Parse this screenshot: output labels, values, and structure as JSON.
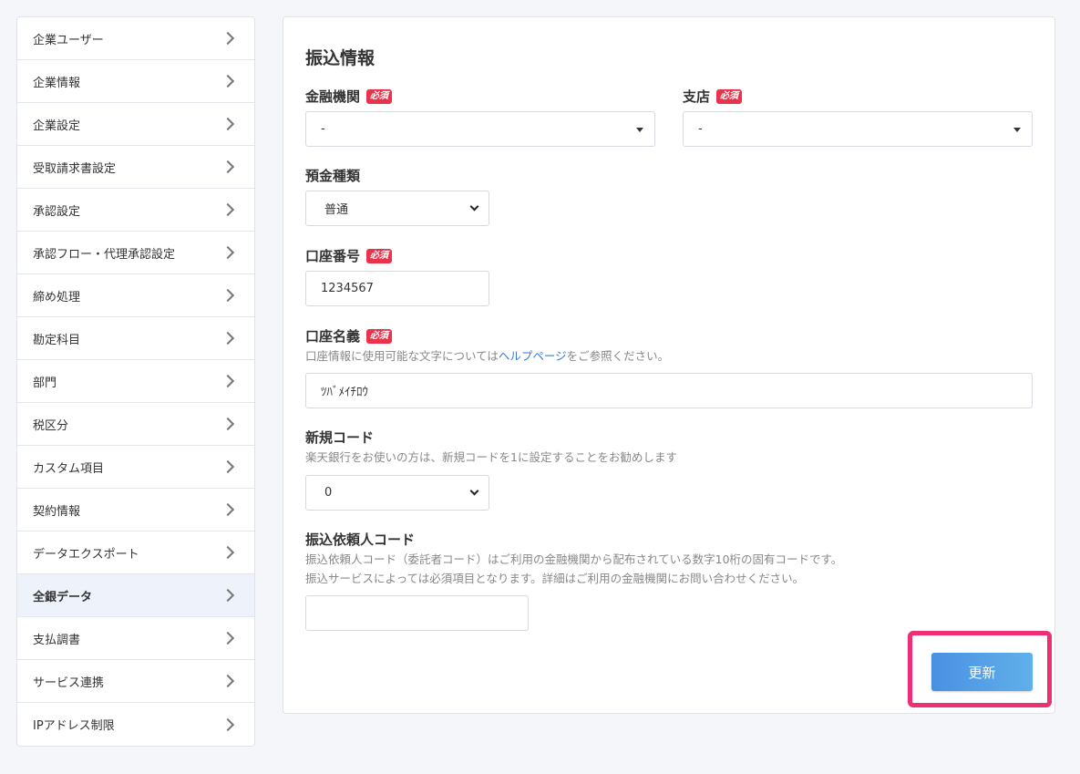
{
  "sidebar": {
    "items": [
      {
        "label": "企業ユーザー"
      },
      {
        "label": "企業情報"
      },
      {
        "label": "企業設定"
      },
      {
        "label": "受取請求書設定"
      },
      {
        "label": "承認設定"
      },
      {
        "label": "承認フロー・代理承認設定"
      },
      {
        "label": "締め処理"
      },
      {
        "label": "勘定科目"
      },
      {
        "label": "部門"
      },
      {
        "label": "税区分"
      },
      {
        "label": "カスタム項目"
      },
      {
        "label": "契約情報"
      },
      {
        "label": "データエクスポート"
      },
      {
        "label": "全銀データ",
        "active": true
      },
      {
        "label": "支払調書"
      },
      {
        "label": "サービス連携"
      },
      {
        "label": "IPアドレス制限"
      }
    ]
  },
  "form": {
    "title": "振込情報",
    "required_badge": "必須",
    "bank": {
      "label": "金融機関",
      "value": "-"
    },
    "branch": {
      "label": "支店",
      "value": "-"
    },
    "deposit_type": {
      "label": "預金種類",
      "value": "普通"
    },
    "account_number": {
      "label": "口座番号",
      "value": "1234567"
    },
    "account_name": {
      "label": "口座名義",
      "help_prefix": "口座情報に使用可能な文字については",
      "help_link": "ヘルプページ",
      "help_suffix": "をご参照ください。",
      "value": "ﾂﾊﾞﾒｲﾁﾛｳ"
    },
    "new_code": {
      "label": "新規コード",
      "help": "楽天銀行をお使いの方は、新規コードを1に設定することをお勧めします",
      "value": "0"
    },
    "requester_code": {
      "label": "振込依頼人コード",
      "help_line1": "振込依頼人コード（委託者コード）はご利用の金融機関から配布されている数字10桁の固有コードです。",
      "help_line2": "振込サービスによっては必須項目となります。詳細はご利用の金融機関にお問い合わせください。",
      "value": ""
    },
    "submit_label": "更新"
  }
}
